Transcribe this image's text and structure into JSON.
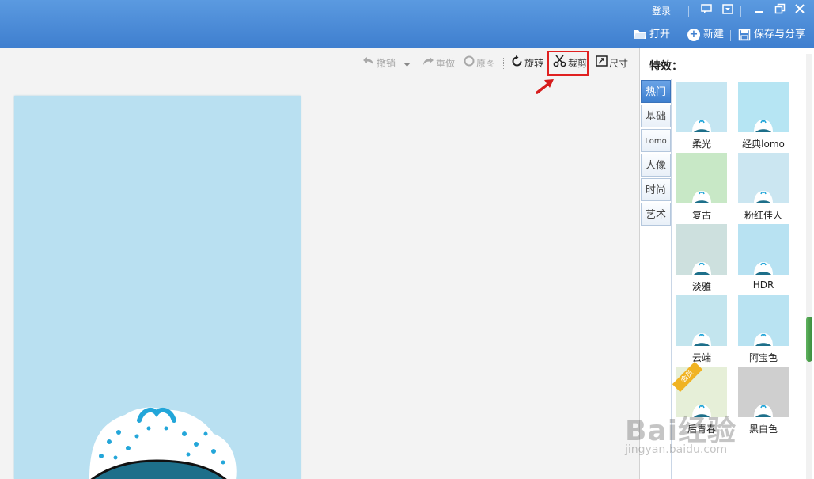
{
  "titlebar": {
    "login_label": "登录",
    "actions": {
      "open_label": "打开",
      "new_label": "新建",
      "save_share_label": "保存与分享"
    },
    "icons": [
      "message-icon",
      "menu-icon",
      "minimize-icon",
      "maximize-icon",
      "close-icon"
    ]
  },
  "toolbar": {
    "undo_label": "撤销",
    "redo_label": "重做",
    "original_label": "原图",
    "rotate_label": "旋转",
    "crop_label": "裁剪",
    "size_label": "尺寸"
  },
  "panel": {
    "title": "特效：",
    "categories": [
      "热门",
      "基础",
      "Lomo",
      "人像",
      "时尚",
      "艺术"
    ],
    "active_category": "热门",
    "effects": [
      {
        "label": "柔光",
        "bg": "#c5e6f2"
      },
      {
        "label": "经典lomo",
        "bg": "#b6e5f3"
      },
      {
        "label": "复古",
        "bg": "#c8e8c6"
      },
      {
        "label": "粉红佳人",
        "bg": "#cbe6f1"
      },
      {
        "label": "淡雅",
        "bg": "#cde0de"
      },
      {
        "label": "HDR",
        "bg": "#b8e2f2"
      },
      {
        "label": "云端",
        "bg": "#c3e5ee"
      },
      {
        "label": "阿宝色",
        "bg": "#b9e3f2"
      },
      {
        "label": "后青春",
        "bg": "#e6efd8",
        "badge": "会员"
      },
      {
        "label": "黑白色",
        "bg": "#cfcfcf"
      }
    ]
  },
  "watermark": {
    "text": "Bai经验",
    "url": "jingyan.baidu.com"
  },
  "colors": {
    "titlebar": "#4a8bd8",
    "canvas": "#b9e0f1",
    "highlight": "#e02020"
  }
}
